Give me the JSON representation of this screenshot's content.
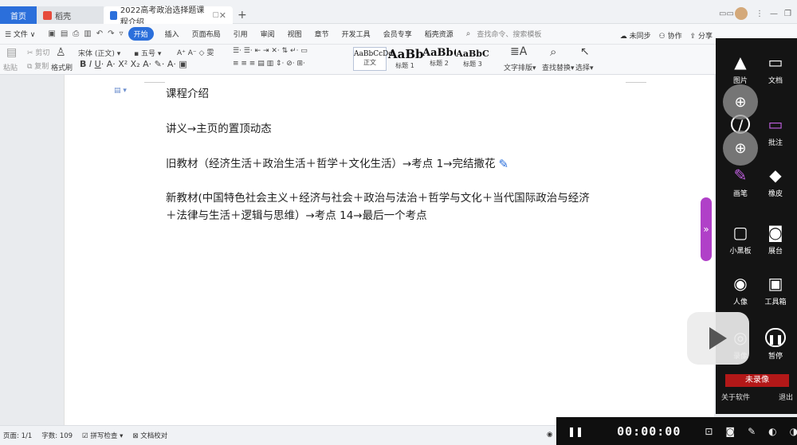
{
  "tabs": {
    "home": "首页",
    "daoke": "稻壳",
    "doc": "2022高考政治选择题课程介绍"
  },
  "menu": {
    "file": "☰ 文件 ∨",
    "items": [
      "开始",
      "插入",
      "页面布局",
      "引用",
      "审阅",
      "视图",
      "章节",
      "开发工具",
      "会员专享",
      "稻壳资源"
    ],
    "search": "查找命令、搜索模板",
    "right": [
      "未同步",
      "协作",
      "分享"
    ]
  },
  "ribbon": {
    "paste": "粘贴",
    "cut": "剪切",
    "copy": "复制",
    "format_painter": "格式刷",
    "font_name": "宋体 (正文)",
    "font_size": "五号",
    "styles": [
      {
        "preview": "AaBbCcDd",
        "label": "正文"
      },
      {
        "preview": "AaBb",
        "label": "标题 1"
      },
      {
        "preview": "AaBb(",
        "label": "标题 2"
      },
      {
        "preview": "AaBbC",
        "label": "标题 3"
      }
    ],
    "text_layout": "文字排版",
    "find_replace": "查找替换",
    "select": "选择"
  },
  "document": {
    "lines": [
      "课程介绍",
      "讲义→主页的置顶动态",
      "旧教材（经济生活＋政治生活＋哲学＋文化生活）→考点 1→完结撒花",
      "新教材(中国特色社会主义＋经济与社会＋政治与法治＋哲学与文化＋当代国际政治与经济",
      "＋法律与生活＋逻辑与思维）→考点 14→最后一个考点"
    ]
  },
  "side_panel": {
    "tools": [
      {
        "label": "图片",
        "icon": "image-icon"
      },
      {
        "label": "文档",
        "icon": "folder-icon"
      },
      {
        "label": "",
        "icon": "highlight-icon"
      },
      {
        "label": "批注",
        "icon": "annotate-icon"
      },
      {
        "label": "画笔",
        "icon": "brush-icon"
      },
      {
        "label": "橡皮",
        "icon": "eraser-icon"
      },
      {
        "label": "小黑板",
        "icon": "blackboard-icon"
      },
      {
        "label": "展台",
        "icon": "projector-icon"
      },
      {
        "label": "人像",
        "icon": "camera-icon"
      },
      {
        "label": "工具箱",
        "icon": "toolbox-icon"
      },
      {
        "label": "录像",
        "icon": "record-icon"
      },
      {
        "label": "暂停",
        "icon": "pause-icon"
      }
    ],
    "unrecorded": "未录像",
    "about": "关于软件",
    "exit": "退出"
  },
  "status": {
    "page": "页面: 1/1",
    "word_count": "字数: 109",
    "spell_check": "拼写检查",
    "proofread": "文档校对"
  },
  "recorder": {
    "time": "00:00:00"
  },
  "colors": {
    "accent": "#2b6fdb",
    "handle": "#b040c8",
    "stop": "#e83a3a"
  }
}
